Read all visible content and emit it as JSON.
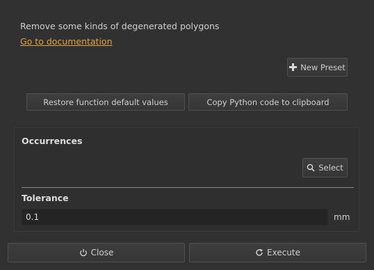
{
  "description": "Remove some kinds of degenerated polygons",
  "doc_link": "Go to documentation",
  "toolbar": {
    "new_preset_label": "New Preset",
    "restore_label": "Restore function default values",
    "copy_python_label": "Copy Python code to clipboard"
  },
  "occurrences": {
    "title": "Occurrences",
    "select_label": "Select"
  },
  "tolerance": {
    "title": "Tolerance",
    "value": "0.1",
    "unit": "mm"
  },
  "footer": {
    "close_label": "Close",
    "execute_label": "Execute"
  },
  "icons": {
    "new_preset": "plus-icon",
    "select": "search-icon",
    "close": "power-icon",
    "execute": "refresh-icon"
  },
  "colors": {
    "background": "#313131",
    "link": "#e8a23a"
  }
}
